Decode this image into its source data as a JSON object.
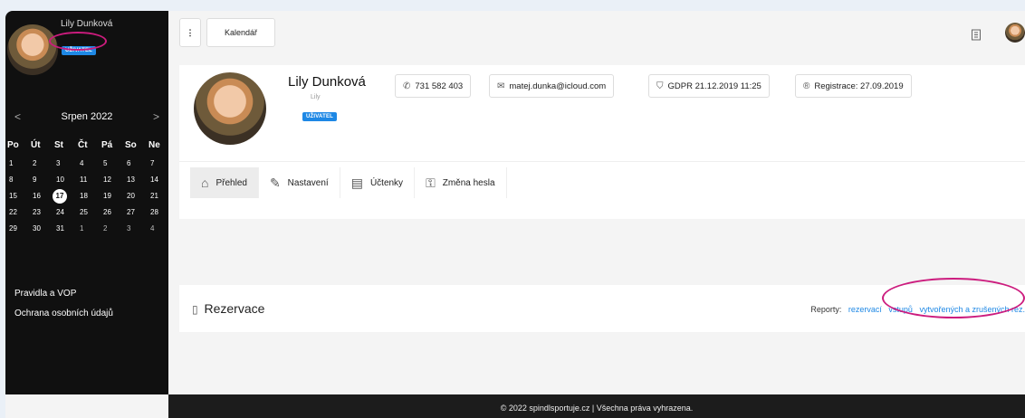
{
  "sidebar": {
    "user_name": "Lily Dunková",
    "user_badge": "UŽIVATEL",
    "calendar": {
      "month": "Srpen 2022",
      "prev": "<",
      "next": ">",
      "weekdays": [
        "Po",
        "Út",
        "St",
        "Čt",
        "Pá",
        "So",
        "Ne"
      ],
      "weeks": [
        [
          "1",
          "2",
          "3",
          "4",
          "5",
          "6",
          "7"
        ],
        [
          "8",
          "9",
          "10",
          "11",
          "12",
          "13",
          "14"
        ],
        [
          "15",
          "16",
          "17",
          "18",
          "19",
          "20",
          "21"
        ],
        [
          "22",
          "23",
          "24",
          "25",
          "26",
          "27",
          "28"
        ],
        [
          "29",
          "30",
          "31",
          "1",
          "2",
          "3",
          "4"
        ]
      ],
      "today": "17"
    },
    "links": [
      "Pravidla a VOP",
      "Ochrana osobních údajů"
    ]
  },
  "topbar": {
    "menu_label": "⋮",
    "calendar_button": "Kalendář",
    "book_icon": "book-icon"
  },
  "profile": {
    "name": "Lily Dunková",
    "subname": "Lily",
    "badge": "UŽIVATEL",
    "phone": "731 582 403",
    "email": "matej.dunka@icloud.com",
    "gdpr": "GDPR 21.12.2019 11:25",
    "registration": "Registrace: 27.09.2019"
  },
  "tabs": [
    {
      "label": "Přehled",
      "icon": "home-icon"
    },
    {
      "label": "Nastavení",
      "icon": "edit-icon"
    },
    {
      "label": "Účtenky",
      "icon": "receipt-icon"
    },
    {
      "label": "Změna hesla",
      "icon": "key-icon"
    }
  ],
  "reservations": {
    "title": "Rezervace",
    "reports_label": "Reporty:",
    "report_links": [
      "rezervací",
      "vstupů",
      "vytvořených a zrušených rez."
    ]
  },
  "footer": "© 2022 spindlsportuje.cz | Všechna práva vyhrazena.",
  "colors": {
    "accent": "#1e88e5",
    "annotation": "#cc1c7e",
    "sidebar": "#101010"
  }
}
